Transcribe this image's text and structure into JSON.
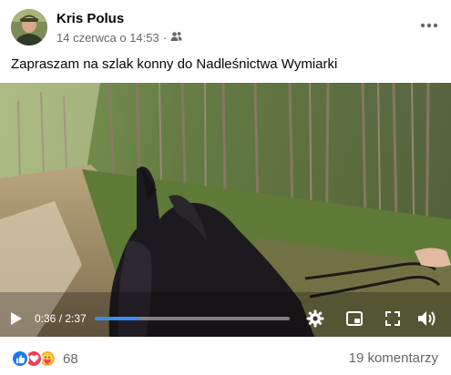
{
  "post": {
    "author": "Kris Polus",
    "timestamp": "14 czerwca o 14:53",
    "separator": "·",
    "audience_icon": "friends-icon",
    "text": "Zapraszam na szlak konny do Nadleśnictwa Wymiarki"
  },
  "video": {
    "time_display": "0:36 / 2:37",
    "progress": 0.23,
    "controls": [
      "play-icon",
      "settings-icon",
      "picture-in-picture-icon",
      "fullscreen-icon",
      "volume-icon"
    ]
  },
  "footer": {
    "reactions": [
      "like",
      "love",
      "care"
    ],
    "reaction_count": "68",
    "comments_label": "19 komentarzy"
  },
  "colors": {
    "accent": "#3b8ded",
    "like": "#1877f2",
    "love": "#f33e58",
    "care": "#f7b125",
    "secondary_text": "#65676b"
  }
}
